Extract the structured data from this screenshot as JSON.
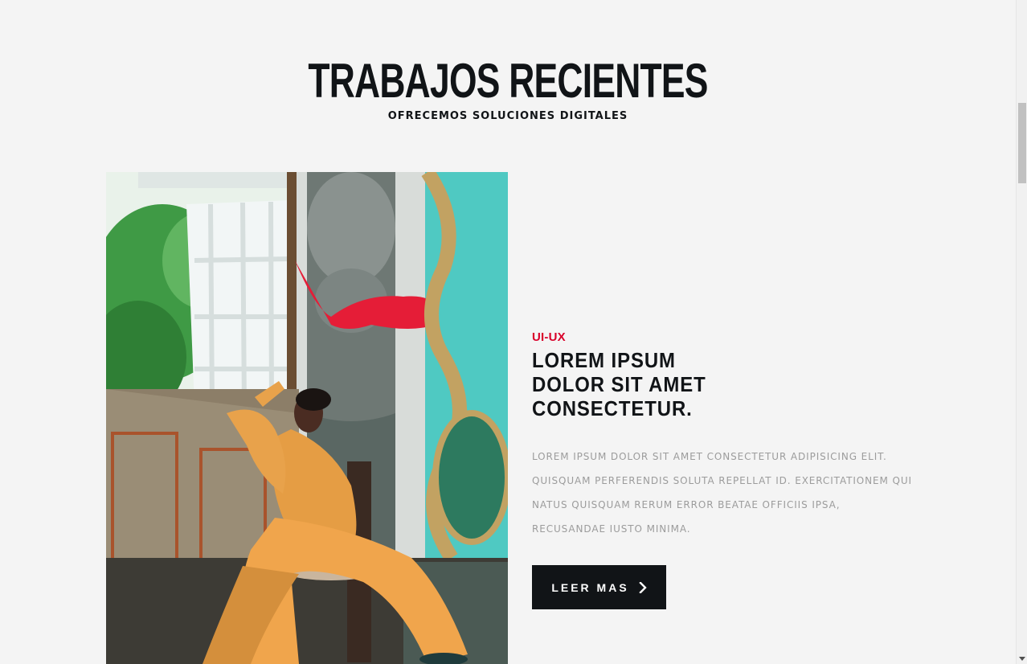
{
  "header": {
    "title": "TRABAJOS RECIENTES",
    "subtitle": "OFRECEMOS SOLUCIONES DIGITALES"
  },
  "project": {
    "category": "UI-UX",
    "title_lines": [
      "LOREM IPSUM",
      "DOLOR SIT AMET",
      "CONSECTETUR."
    ],
    "description": "LOREM IPSUM DOLOR SIT AMET CONSECTETUR ADIPISICING ELIT. QUISQUAM PERFERENDIS SOLUTA REPELLAT ID. EXERCITATIONEM QUI NATUS QUISQUAM RERUM ERROR BEATAE OFFICIIS IPSA, RECUSANDAE IUSTO MINIMA.",
    "button_label": "LEER MAS",
    "button_icon": "chevron-right-icon"
  },
  "colors": {
    "background": "#f4f4f4",
    "text_dark": "#111417",
    "accent": "#d9002a",
    "muted": "#9c9c9c",
    "button_bg": "#111417"
  }
}
